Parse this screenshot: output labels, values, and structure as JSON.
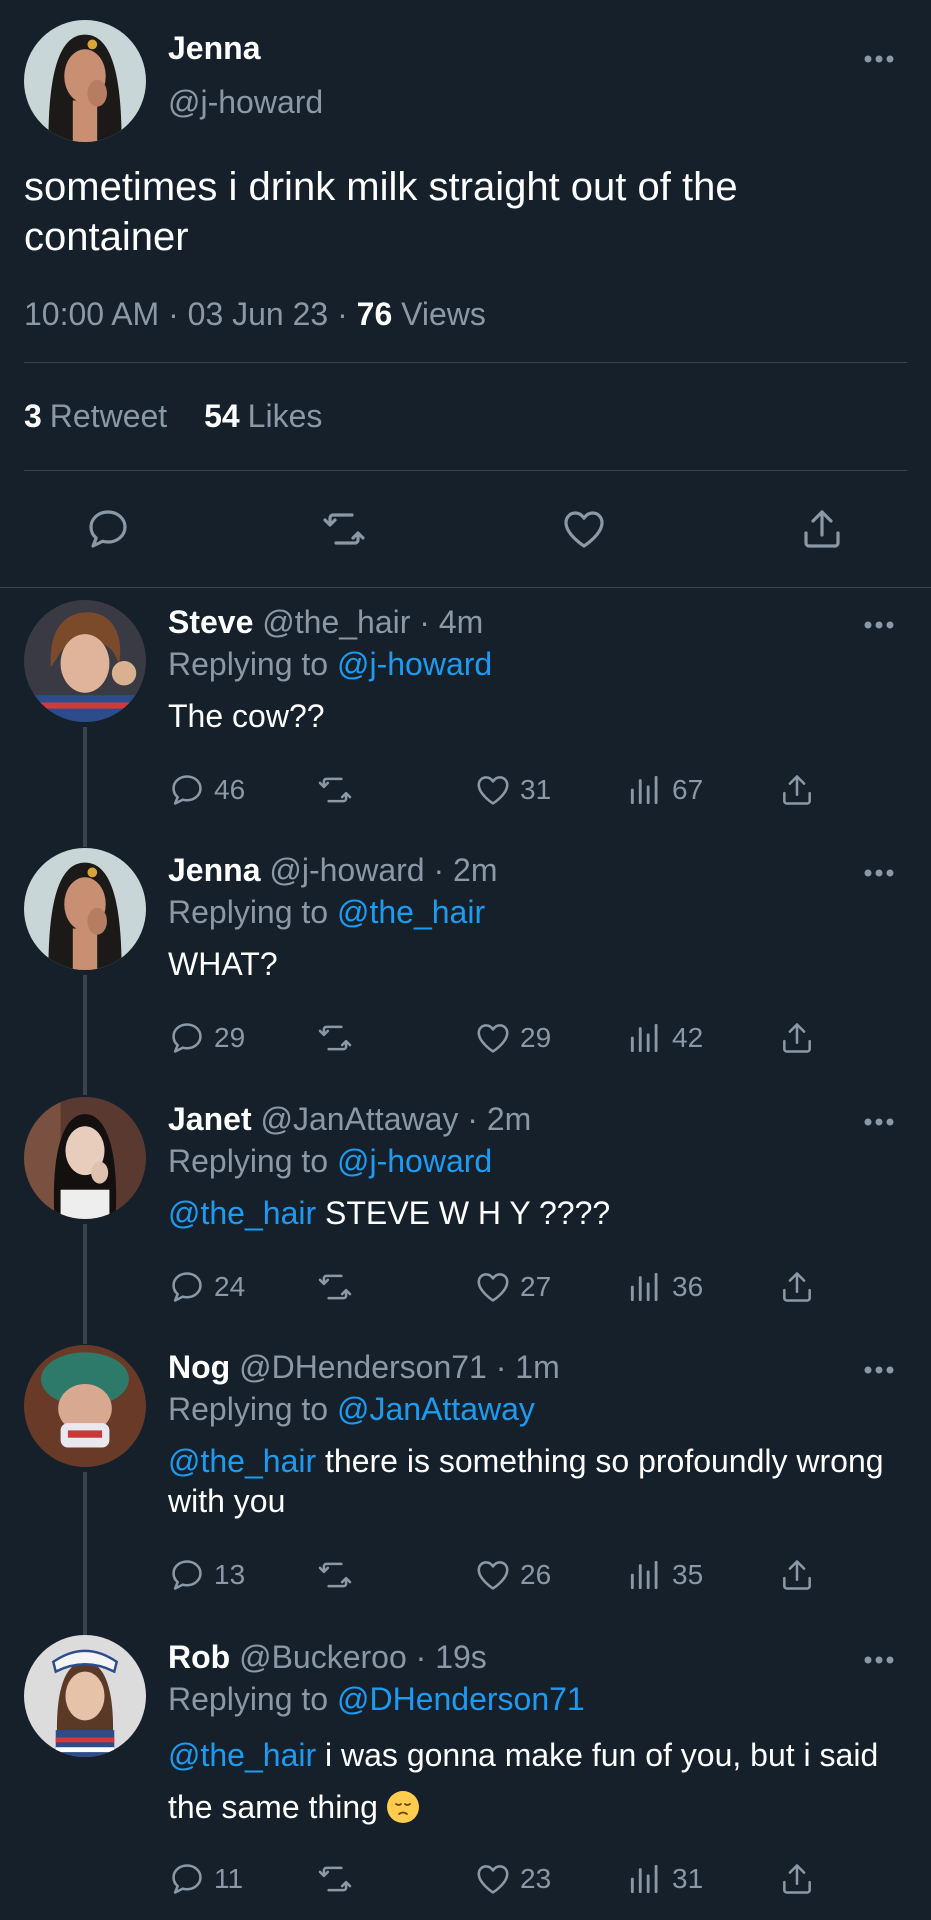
{
  "colors": {
    "background": "#15202b",
    "muted": "#8b98a5",
    "link": "#1d9bf0",
    "divider": "#38444d"
  },
  "main": {
    "name": "Jenna",
    "handle": "@j-howard",
    "text": "sometimes i drink milk straight out of the container",
    "time": "10:00 AM",
    "date": "03 Jun 23",
    "views_count": "76",
    "views_label": "Views",
    "retweet_count": "3",
    "retweet_label": "Retweet",
    "likes_count": "54",
    "likes_label": "Likes",
    "icons": [
      "reply-icon",
      "retweet-icon",
      "like-icon",
      "share-icon"
    ]
  },
  "replies": [
    {
      "name": "Steve",
      "handle": "@the_hair",
      "time": "4m",
      "replying_label": "Replying to",
      "replying_to": "@j-howard",
      "mention": "",
      "text": "The cow??",
      "emoji": "",
      "replies": "46",
      "likes": "31",
      "views": "67"
    },
    {
      "name": "Jenna",
      "handle": "@j-howard",
      "time": "2m",
      "replying_label": "Replying to",
      "replying_to": "@the_hair",
      "mention": "",
      "text": "WHAT?",
      "emoji": "",
      "replies": "29",
      "likes": "29",
      "views": "42"
    },
    {
      "name": "Janet",
      "handle": "@JanAttaway",
      "time": "2m",
      "replying_label": "Replying to",
      "replying_to": "@j-howard",
      "mention": "@the_hair",
      "text": " STEVE W H Y ????",
      "emoji": "",
      "replies": "24",
      "likes": "27",
      "views": "36"
    },
    {
      "name": "Nog",
      "handle": "@DHenderson71",
      "time": "1m",
      "replying_label": "Replying to",
      "replying_to": "@JanAttaway",
      "mention": "@the_hair",
      "text": " there is something so profoundly wrong with you",
      "emoji": "",
      "replies": "13",
      "likes": "26",
      "views": "35"
    },
    {
      "name": "Rob",
      "handle": "@Buckeroo",
      "time": "19s",
      "replying_label": "Replying to",
      "replying_to": "@DHenderson71",
      "mention": "@the_hair",
      "text": " i was gonna make fun of you, but i said the same thing ",
      "emoji": "pensive-face",
      "replies": "11",
      "likes": "23",
      "views": "31"
    }
  ]
}
